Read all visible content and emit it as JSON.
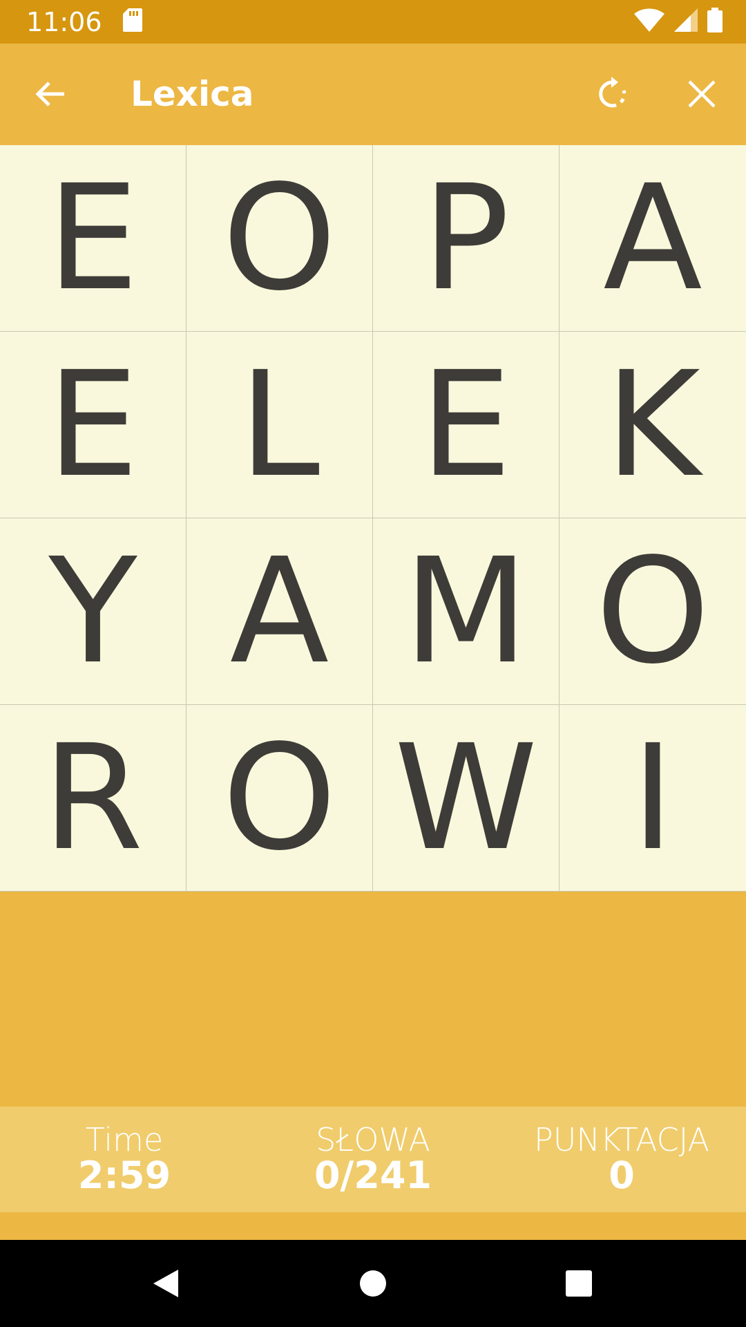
{
  "status_bar": {
    "time": "11:06",
    "icons": [
      "sd-card-icon",
      "wifi-icon",
      "signal-icon",
      "battery-icon"
    ]
  },
  "app_bar": {
    "title": "Lexica",
    "actions": [
      "back-arrow-icon",
      "refresh-icon",
      "close-icon"
    ]
  },
  "board": {
    "rows": [
      [
        "E",
        "O",
        "P",
        "A"
      ],
      [
        "E",
        "L",
        "E",
        "K"
      ],
      [
        "Y",
        "A",
        "M",
        "O"
      ],
      [
        "R",
        "O",
        "W",
        "I"
      ]
    ]
  },
  "stats": {
    "time_label": "Time",
    "time_value": "2:59",
    "words_label": "SŁOWA",
    "words_value": "0/241",
    "score_label": "PUNKTACJA",
    "score_value": "0"
  },
  "colors": {
    "status_bar": "#d7960f",
    "app_bar": "#ecb743",
    "tile": "#f9f8dc",
    "stats_bar": "#f0cc6c",
    "letter": "#3d3c38"
  }
}
